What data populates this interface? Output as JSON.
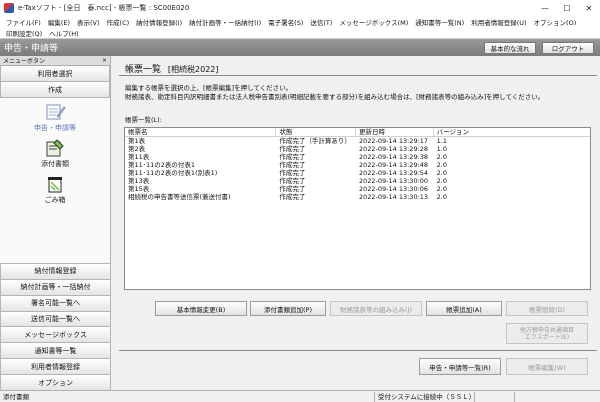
{
  "window": {
    "title": "e-Taxソフト - [全日　泰.ncc] - 帳票一覧 : SC00E020",
    "min": "—",
    "max": "☐",
    "close": "✕"
  },
  "menubar": {
    "row1": [
      "ファイル(F)",
      "編集(E)",
      "表示(V)",
      "作成(C)",
      "納付情報登録(I)",
      "納付計画等・一括納付(I)",
      "電子署名(S)",
      "送信(T)",
      "メッセージボックス(M)",
      "通知書等一覧(N)",
      "利用者情報登録(U)",
      "オプション(O)"
    ],
    "row2": [
      "印刷設定(Q)",
      "ヘルプ(H)"
    ]
  },
  "header": {
    "title": "申告・申請等",
    "basic_flow_button": "基本的な流れ",
    "logout_button": "ログアウト"
  },
  "sidebar": {
    "menu_button_label": "メニューボタン",
    "close_label": "×",
    "user_select": "利用者選択",
    "create": "作成",
    "tiles": [
      {
        "label": "申告・申請等"
      },
      {
        "label": "添付書類"
      },
      {
        "label": "ごみ箱"
      }
    ],
    "bottom_items": [
      "納付情報登録",
      "納付計画等・一括納付",
      "署名可能一覧へ",
      "送信可能一覧へ",
      "メッセージボックス",
      "通知書等一覧",
      "利用者情報登録",
      "オプション"
    ]
  },
  "main": {
    "title": "帳票一覧",
    "subtitle": "[相続税2022]",
    "instruction_line1": "編集する帳票を選択の上、[帳票編集]を押してください。",
    "instruction_line2": "財務諸表、勘定科目内訳明細書または法人税申告書別表(明細記載を要する部分)を組み込む場合は、[財務諸表等の組み込み]を押してください。",
    "list_label": "帳票一覧(L):",
    "columns": [
      "帳票名",
      "状態",
      "更新日時",
      "バージョン"
    ],
    "rows": [
      [
        "第1表",
        "作成完了（手計算あり）",
        "2022-09-14 13:29:17",
        "1.1"
      ],
      [
        "第2表",
        "作成完了",
        "2022-09-14 13:29:28",
        "1.0"
      ],
      [
        "第11表",
        "作成完了",
        "2022-09-14 13:29:38",
        "2.0"
      ],
      [
        "第11･11の2表の付表1",
        "作成完了",
        "2022-09-14 13:29:48",
        "2.0"
      ],
      [
        "第11･11の2表の付表1(別表1)",
        "作成完了",
        "2022-09-14 13:29:54",
        "2.0"
      ],
      [
        "第13表",
        "作成完了",
        "2022-09-14 13:30:00",
        "2.0"
      ],
      [
        "第15表",
        "作成完了",
        "2022-09-14 13:30:06",
        "2.0"
      ],
      [
        "相続税の申告書等送信票(兼送付書)",
        "作成完了",
        "2022-09-14 13:30:13",
        "2.0"
      ]
    ]
  },
  "buttons": {
    "basic_info_change": "基本情報変更(B)",
    "attach_add": "添付書類追加(P)",
    "financial_embed": "財務諸表等の組み込み(J)",
    "form_add": "帳票追加(A)",
    "form_delete": "帳票削除(D)",
    "export_line1": "他方税申告共通項目",
    "export_line2": "エクスポート(E)",
    "declaration_list": "申告・申請等一覧(R)",
    "form_edit": "帳票編集(W)"
  },
  "statusbar": {
    "left": "添付書類",
    "connection": "受付システムに接続中（ＳＳＬ）"
  },
  "colors": {
    "header_bar": "#888888",
    "active_tile_label": "#5a78b8"
  }
}
